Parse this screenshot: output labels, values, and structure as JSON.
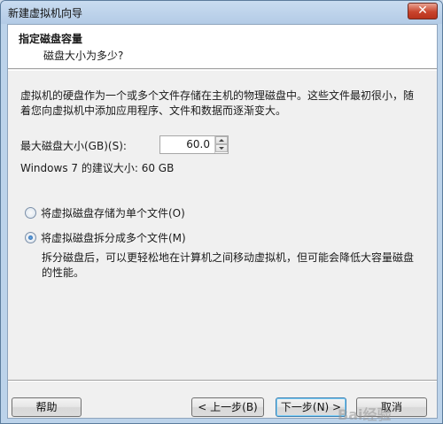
{
  "window": {
    "title": "新建虚拟机向导",
    "close_glyph": "✕"
  },
  "header": {
    "title": "指定磁盘容量",
    "subtitle": "磁盘大小为多少?"
  },
  "description": "虚拟机的硬盘作为一个或多个文件存储在主机的物理磁盘中。这些文件最初很小，随着您向虚拟机中添加应用程序、文件和数据而逐渐变大。",
  "disk_size": {
    "label": "最大磁盘大小(GB)(S):",
    "value": "60.0"
  },
  "recommendation": "Windows 7 的建议大小: 60 GB",
  "options": [
    {
      "label": "将虚拟磁盘存储为单个文件(O)",
      "checked": false
    },
    {
      "label": "将虚拟磁盘拆分成多个文件(M)",
      "checked": true
    }
  ],
  "split_description": "拆分磁盘后，可以更轻松地在计算机之间移动虚拟机，但可能会降低大容量磁盘的性能。",
  "buttons": {
    "help": "帮助",
    "back": "< 上一步(B)",
    "next": "下一步(N) >",
    "cancel": "取消"
  },
  "watermark": "Bai经验"
}
